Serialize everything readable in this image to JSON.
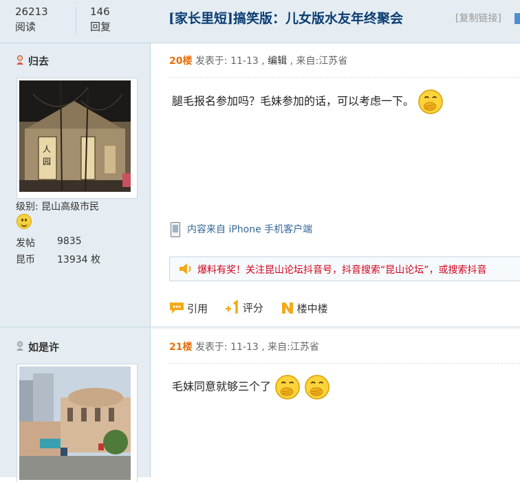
{
  "header": {
    "views_count": "26213",
    "views_label": "阅读",
    "replies_count": "146",
    "replies_label": "回复",
    "title": "[家长里短]搞笑版：儿女版水友年终聚会",
    "copy_link": "[复制链接]"
  },
  "posts": [
    {
      "user": {
        "name": "归去",
        "level": "级别: 昆山高级市民",
        "posts_label": "发帖",
        "posts": "9835",
        "coins_label": "昆币",
        "coins": "13934 枚"
      },
      "floor": "20楼",
      "meta_posted": "发表于: 11-13 ,",
      "meta_edit": "编辑",
      "meta_from": ", 来自:江苏省",
      "content": "腿毛报名参加吗？毛妹参加的话，可以考虑一下。",
      "client": "内容来自 iPhone 手机客户端",
      "notice": "爆料有奖！关注昆山论坛抖音号，抖音搜索“昆山论坛”，或搜索抖音",
      "actions": {
        "quote": "引用",
        "rate": "评分",
        "floor_in_floor": "楼中楼"
      }
    },
    {
      "user": {
        "name": "如是许"
      },
      "floor": "21楼",
      "meta_posted": "发表于: 11-13 , 来自:江苏省",
      "content": "毛妹同意就够三个了"
    }
  ]
}
